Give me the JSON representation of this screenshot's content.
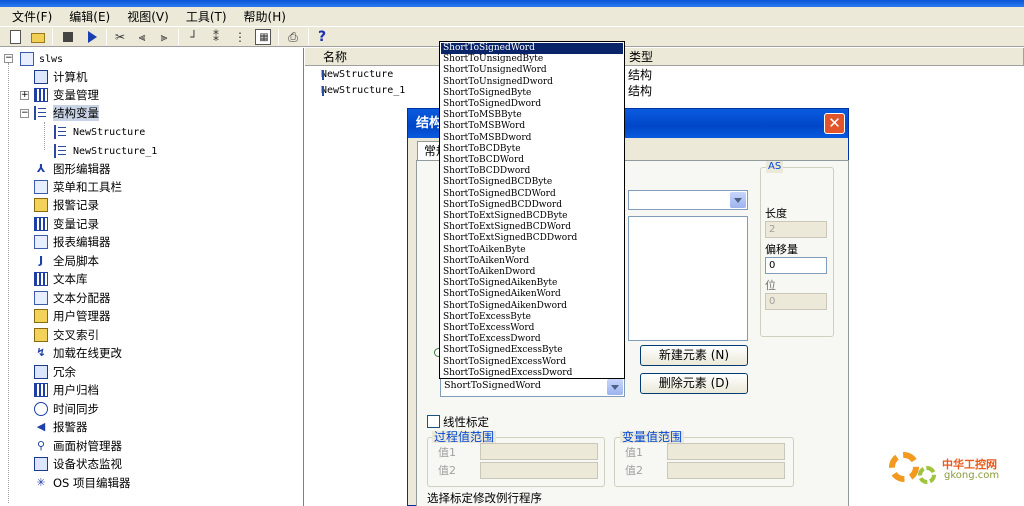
{
  "menu": [
    "文件(F)",
    "编辑(E)",
    "视图(V)",
    "工具(T)",
    "帮助(H)"
  ],
  "toolbar": {
    "icons": [
      "new-icon",
      "open-icon",
      "stop-icon",
      "run-icon",
      "cut-icon",
      "align-left-icon",
      "align-right-icon",
      "align-top-icon",
      "align-bottom-icon",
      "distribute-icon",
      "table-icon",
      "print-icon",
      "help-icon"
    ],
    "help_label": "?"
  },
  "tree": {
    "root": "slws",
    "items": [
      {
        "label": "计算机",
        "icon": "computer-icon"
      },
      {
        "label": "变量管理",
        "icon": "tag-management-icon"
      },
      {
        "label": "结构变量",
        "icon": "structure-variable-icon"
      },
      {
        "label": "NewStructure",
        "icon": "structure-icon"
      },
      {
        "label": "NewStructure_1",
        "icon": "structure-icon"
      },
      {
        "label": "图形编辑器",
        "icon": "graphics-editor-icon"
      },
      {
        "label": "菜单和工具栏",
        "icon": "menu-toolbar-icon"
      },
      {
        "label": "报警记录",
        "icon": "alarm-logging-icon"
      },
      {
        "label": "变量记录",
        "icon": "tag-logging-icon"
      },
      {
        "label": "报表编辑器",
        "icon": "report-editor-icon"
      },
      {
        "label": "全局脚本",
        "icon": "global-script-icon"
      },
      {
        "label": "文本库",
        "icon": "text-library-icon"
      },
      {
        "label": "文本分配器",
        "icon": "text-distributor-icon"
      },
      {
        "label": "用户管理器",
        "icon": "user-administrator-icon"
      },
      {
        "label": "交叉索引",
        "icon": "cross-reference-icon"
      },
      {
        "label": "加载在线更改",
        "icon": "load-online-changes-icon"
      },
      {
        "label": "冗余",
        "icon": "redundancy-icon"
      },
      {
        "label": "用户归档",
        "icon": "user-archive-icon"
      },
      {
        "label": "时间同步",
        "icon": "time-sync-icon"
      },
      {
        "label": "报警器",
        "icon": "horn-icon"
      },
      {
        "label": "画面树管理器",
        "icon": "picture-tree-icon"
      },
      {
        "label": "设备状态监视",
        "icon": "device-status-icon"
      },
      {
        "label": "OS 项目编辑器",
        "icon": "os-project-editor-icon"
      }
    ]
  },
  "list": {
    "columns": [
      "名称",
      "类型"
    ],
    "rows": [
      {
        "name": "NewStructure",
        "type": "结构"
      },
      {
        "name": "NewStructure_1",
        "type": "结构"
      }
    ]
  },
  "dialog": {
    "title": "结构",
    "close": "✕",
    "tab": "常规",
    "new_element": "新建元素 (N)",
    "delete_element": "删除元素 (D)",
    "format_value": "ShortToSignedWord",
    "as_group": "AS",
    "length_label": "长度",
    "length_value": "2",
    "offset_label": "偏移量",
    "offset_value": "0",
    "bit_label": "位",
    "bit_value": "0",
    "linear_scaling": "线性标定",
    "process_range": "过程值范围",
    "tag_range": "变量值范围",
    "value1": "值1",
    "value2": "值2",
    "select_routine": "选择标定修改例行程序"
  },
  "dropdown": {
    "selected_index": 0,
    "items": [
      "ShortToSignedWord",
      "ShortToUnsignedByte",
      "ShortToUnsignedWord",
      "ShortToUnsignedDword",
      "ShortToSignedByte",
      "ShortToSignedDword",
      "ShortToMSBByte",
      "ShortToMSBWord",
      "ShortToMSBDword",
      "ShortToBCDByte",
      "ShortToBCDWord",
      "ShortToBCDDword",
      "ShortToSignedBCDByte",
      "ShortToSignedBCDWord",
      "ShortToSignedBCDDword",
      "ShortToExtSignedBCDByte",
      "ShortToExtSignedBCDWord",
      "ShortToExtSignedBCDDword",
      "ShortToAikenByte",
      "ShortToAikenWord",
      "ShortToAikenDword",
      "ShortToSignedAikenByte",
      "ShortToSignedAikenWord",
      "ShortToSignedAikenDword",
      "ShortToExcessByte",
      "ShortToExcessWord",
      "ShortToExcessDword",
      "ShortToSignedExcessByte",
      "ShortToSignedExcessWord",
      "ShortToSignedExcessDword"
    ]
  },
  "watermark": {
    "text": "中华工控网",
    "url": "gkong.com"
  }
}
